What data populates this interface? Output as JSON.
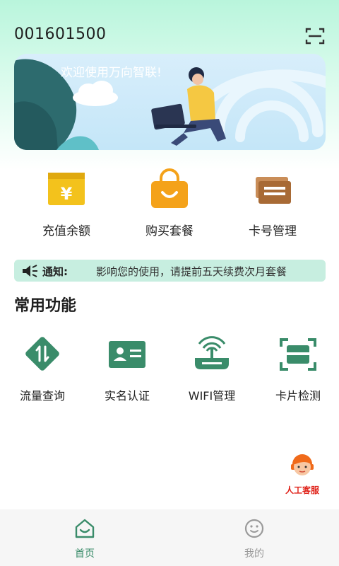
{
  "header": {
    "card_number": "001601500"
  },
  "banner": {
    "text": "欢迎使用万向智联!"
  },
  "quick_actions": [
    {
      "label": "充值余额",
      "icon": "yuan-card-icon",
      "color": "#f3c21c"
    },
    {
      "label": "购买套餐",
      "icon": "shopping-bag-icon",
      "color": "#f4a21a"
    },
    {
      "label": "卡号管理",
      "icon": "cards-icon",
      "color": "#a86a35"
    }
  ],
  "notice": {
    "tag": "通知:",
    "message": "影响您的使用，请提前五天续费次月套餐"
  },
  "section_title": "常用功能",
  "functions": [
    {
      "label": "流量查询",
      "icon": "data-transfer-icon"
    },
    {
      "label": "实名认证",
      "icon": "id-card-icon"
    },
    {
      "label": "WIFI管理",
      "icon": "wifi-router-icon"
    },
    {
      "label": "卡片检测",
      "icon": "scan-card-icon"
    }
  ],
  "service": {
    "label": "人工客服"
  },
  "tabbar": [
    {
      "label": "首页",
      "icon": "home-icon",
      "active": true
    },
    {
      "label": "我的",
      "icon": "smiley-face-icon",
      "active": false
    }
  ],
  "colors": {
    "accent": "#3a8c6a",
    "notice_bg": "#c7eee0",
    "service_red": "#e0241b"
  }
}
